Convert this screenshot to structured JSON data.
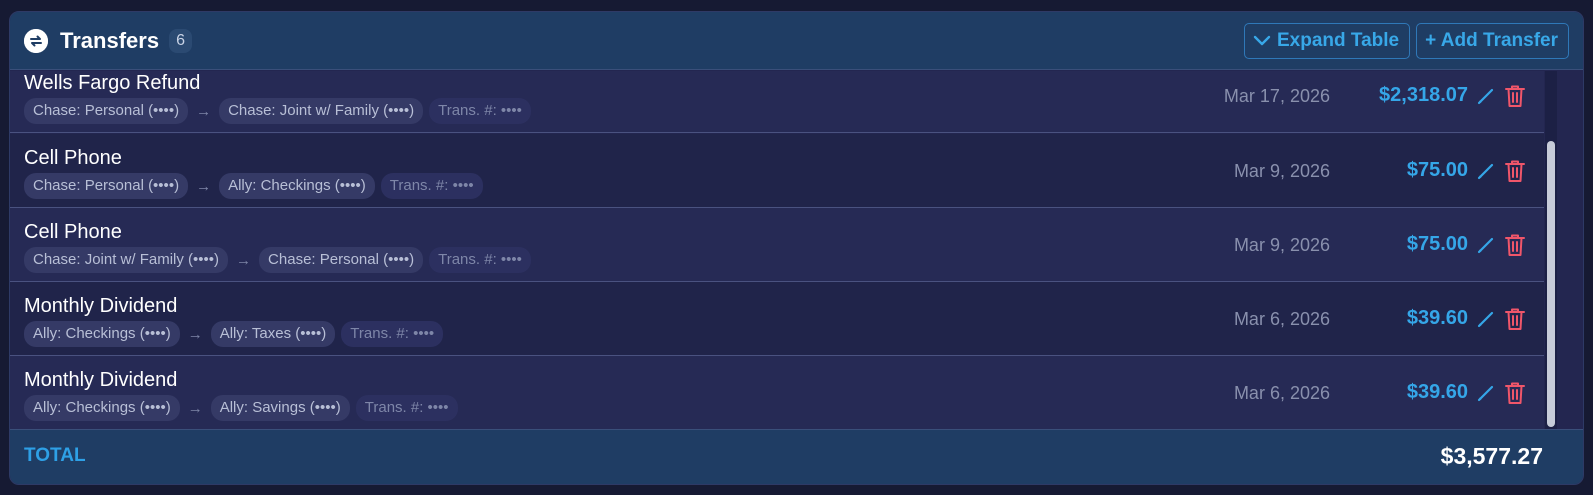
{
  "header": {
    "title": "Transfers",
    "count": "6",
    "expand_label": "Expand Table",
    "add_label": "+ Add Transfer"
  },
  "rows": [
    {
      "title": "Wells Fargo Refund",
      "from": "Chase: Personal (••••)",
      "to": "Chase: Joint w/ Family (••••)",
      "trans": "Trans. #: ••••",
      "date": "Mar 17, 2026",
      "amount": "$2,318.07"
    },
    {
      "title": "Cell Phone",
      "from": "Chase: Personal (••••)",
      "to": "Ally: Checkings (••••)",
      "trans": "Trans. #: ••••",
      "date": "Mar 9, 2026",
      "amount": "$75.00"
    },
    {
      "title": "Cell Phone",
      "from": "Chase: Joint w/ Family (••••)",
      "to": "Chase: Personal (••••)",
      "trans": "Trans. #: ••••",
      "date": "Mar 9, 2026",
      "amount": "$75.00"
    },
    {
      "title": "Monthly Dividend",
      "from": "Ally: Checkings (••••)",
      "to": "Ally: Taxes (••••)",
      "trans": "Trans. #: ••••",
      "date": "Mar 6, 2026",
      "amount": "$39.60"
    },
    {
      "title": "Monthly Dividend",
      "from": "Ally: Checkings (••••)",
      "to": "Ally: Savings (••••)",
      "trans": "Trans. #: ••••",
      "date": "Mar 6, 2026",
      "amount": "$39.60"
    }
  ],
  "arrow": "→",
  "footer": {
    "label": "TOTAL",
    "total": "$3,577.27"
  },
  "colors": {
    "accent": "#35a6e8",
    "delete": "#f0566a",
    "header_bg": "#1f3d64",
    "row_bg": "#232650"
  },
  "icons": {
    "header": "transfer-icon",
    "expand": "chevron-down-icon",
    "edit": "pencil-icon",
    "delete": "trash-icon"
  }
}
